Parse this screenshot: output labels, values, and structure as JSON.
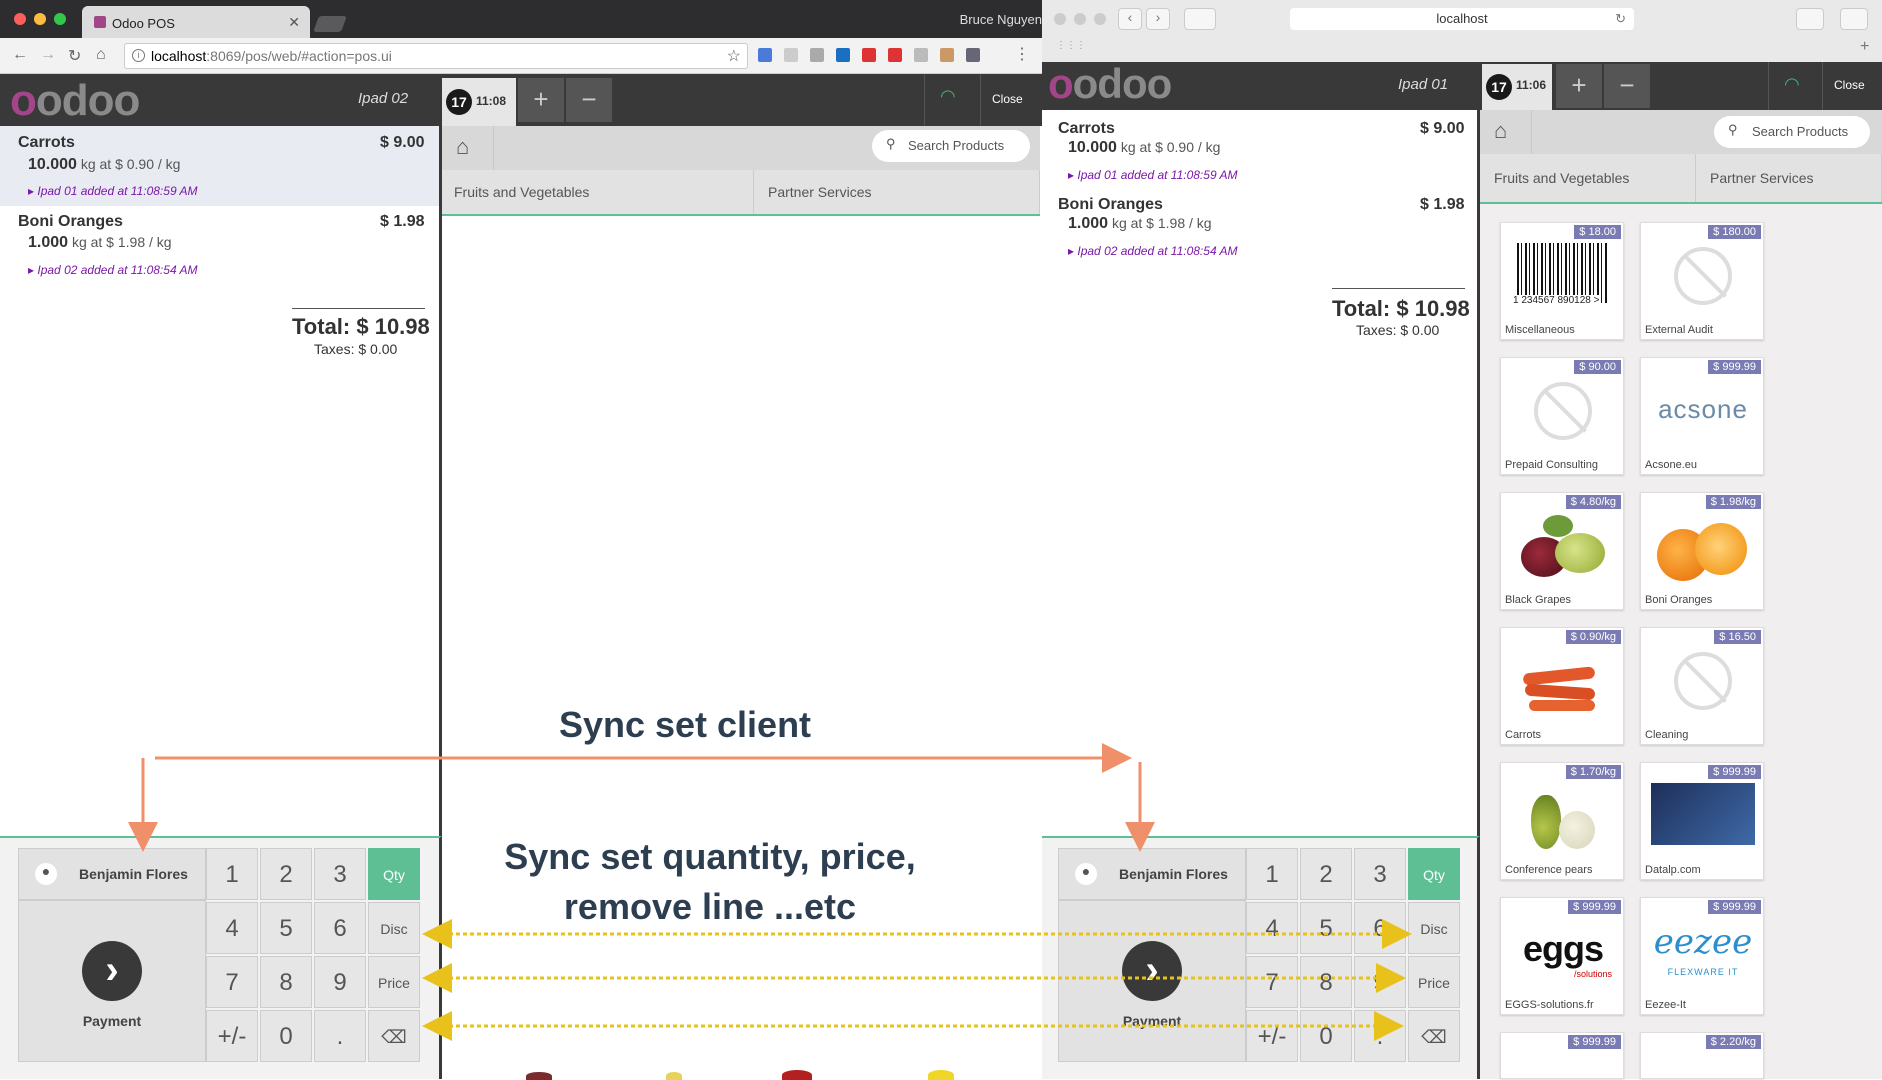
{
  "left_browser": {
    "tab_title": "Odoo POS",
    "user": "Bruce Nguyen",
    "url_host": "localhost",
    "url_rest": ":8069/pos/web/#action=pos.ui"
  },
  "right_browser": {
    "address": "localhost"
  },
  "left_pos": {
    "device": "Ipad 02",
    "ticket": "17",
    "time": "11:08",
    "close": "Close",
    "lines": [
      {
        "name": "Carrots",
        "price": "$ 9.00",
        "qty": "10.000",
        "unit_info": "kg at $ 0.90 / kg",
        "note": "Ipad 01 added at 11:08:59 AM"
      },
      {
        "name": "Boni Oranges",
        "price": "$ 1.98",
        "qty": "1.000",
        "unit_info": "kg at $ 1.98 / kg",
        "note": "Ipad 02 added at 11:08:54 AM"
      }
    ],
    "total": "Total: $ 10.98",
    "taxes": "Taxes: $ 0.00",
    "search_placeholder": "Search Products",
    "categories": [
      "Fruits and Vegetables",
      "Partner Services"
    ],
    "customer": "Benjamin Flores",
    "payment": "Payment"
  },
  "right_pos": {
    "device": "Ipad 01",
    "ticket": "17",
    "time": "11:06",
    "close": "Close",
    "lines": [
      {
        "name": "Carrots",
        "price": "$ 9.00",
        "qty": "10.000",
        "unit_info": "kg at $ 0.90 / kg",
        "note": "Ipad 01 added at 11:08:59 AM"
      },
      {
        "name": "Boni Oranges",
        "price": "$ 1.98",
        "qty": "1.000",
        "unit_info": "kg at $ 1.98 / kg",
        "note": "Ipad 02 added at 11:08:54 AM"
      }
    ],
    "total": "Total: $ 10.98",
    "taxes": "Taxes: $ 0.00",
    "search_placeholder": "Search Products",
    "categories": [
      "Fruits and Vegetables",
      "Partner Services"
    ],
    "customer": "Benjamin Flores",
    "payment": "Payment",
    "products": [
      {
        "name": "Miscellaneous",
        "price": "$ 18.00"
      },
      {
        "name": "External Audit",
        "price": "$ 180.00"
      },
      {
        "name": "Prepaid Consulting",
        "price": "$ 90.00"
      },
      {
        "name": "Acsone.eu",
        "price": "$ 999.99"
      },
      {
        "name": "Black Grapes",
        "price": "$ 4.80/kg"
      },
      {
        "name": "Boni Oranges",
        "price": "$ 1.98/kg"
      },
      {
        "name": "Carrots",
        "price": "$ 0.90/kg"
      },
      {
        "name": "Cleaning",
        "price": "$ 16.50"
      },
      {
        "name": "Conference pears",
        "price": "$ 1.70/kg"
      },
      {
        "name": "Datalp.com",
        "price": "$ 999.99"
      },
      {
        "name": "EGGS-solutions.fr",
        "price": "$ 999.99"
      },
      {
        "name": "Eezee-It",
        "price": "$ 999.99"
      },
      {
        "name": "",
        "price": "$ 999.99"
      },
      {
        "name": "",
        "price": "$ 2.20/kg"
      }
    ],
    "barcode_text": "1 234567 890128 >",
    "acsone_logo": "acsone",
    "eggs_logo": "eggs",
    "eggs_sub": "/solutions",
    "eezee_logo": "eezee",
    "eezee_sub": "FLEXWARE IT"
  },
  "numpad": {
    "keys": [
      "1",
      "2",
      "3",
      "4",
      "5",
      "6",
      "7",
      "8",
      "9",
      "+/-",
      "0",
      "."
    ],
    "qty": "Qty",
    "disc": "Disc",
    "price": "Price",
    "backspace": "⌫"
  },
  "annotations": {
    "client": "Sync set client",
    "qty_line1": "Sync set quantity, price,",
    "qty_line2": "remove line ...etc"
  },
  "colors": {
    "pos_dark": "#393939",
    "accent": "#5fbf94",
    "note": "#7b18a8",
    "arrow_orange": "#f0906a",
    "arrow_yellow": "#e8c21a",
    "price_badge": "#7b7bb3"
  },
  "brand": "odoo"
}
